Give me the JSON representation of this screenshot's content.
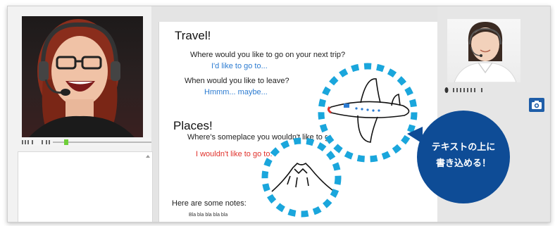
{
  "board": {
    "title_travel": "Travel!",
    "q1": "Where would you like to go on your next trip?",
    "a1": "I'd like to go to...",
    "q2": "When would you like to leave?",
    "a2": "Hmmm... maybe...",
    "title_places": "Places!",
    "q3": "Where's someplace you wouldn't like to go?",
    "a3": "I wouldn't like to go to...",
    "notes_label": "Here are some notes:",
    "notes_text": "Bla bla bla bla bla"
  },
  "callout": {
    "line1": "テキストの上に",
    "line2": "書き込める！"
  },
  "icons": {
    "camera": "camera-icon",
    "volume": "volume-icon",
    "mic": "microphone-icon"
  },
  "colors": {
    "accent_blue": "#2b7bd1",
    "accent_red": "#e0302a",
    "callout_navy": "#0e4c96",
    "dotted_cyan": "#1aa6dc",
    "volume_green": "#6fcf3a"
  }
}
